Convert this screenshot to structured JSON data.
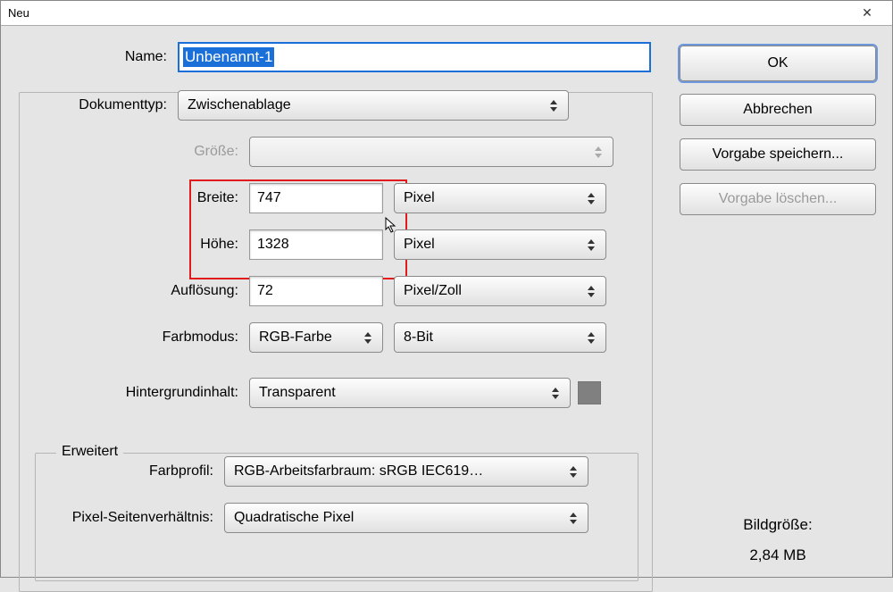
{
  "window": {
    "title": "Neu",
    "close": "✕"
  },
  "labels": {
    "name": "Name:",
    "doctype": "Dokumenttyp:",
    "size": "Größe:",
    "width": "Breite:",
    "height": "Höhe:",
    "resolution": "Auflösung:",
    "colormode": "Farbmodus:",
    "bgcontent": "Hintergrundinhalt:",
    "advanced": "Erweitert",
    "colorprofile": "Farbprofil:",
    "pixelaspect": "Pixel-Seitenverhältnis:"
  },
  "values": {
    "name": "Unbenannt-1",
    "doctype": "Zwischenablage",
    "size": "",
    "width": "747",
    "height": "1328",
    "resolution": "72",
    "width_unit": "Pixel",
    "height_unit": "Pixel",
    "resolution_unit": "Pixel/Zoll",
    "colormode": "RGB-Farbe",
    "colordepth": "8-Bit",
    "bgcontent": "Transparent",
    "colorprofile": "RGB-Arbeitsfarbraum:  sRGB IEC619…",
    "pixelaspect": "Quadratische Pixel"
  },
  "buttons": {
    "ok": "OK",
    "cancel": "Abbrechen",
    "savepreset": "Vorgabe speichern...",
    "deletepreset": "Vorgabe löschen..."
  },
  "imagesize": {
    "label": "Bildgröße:",
    "value": "2,84 MB"
  }
}
